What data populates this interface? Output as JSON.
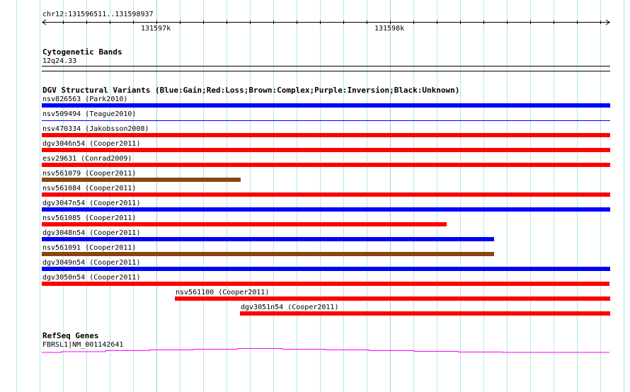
{
  "ruler": {
    "range_label": "chr12:131596511..131598937",
    "tick_labels": [
      "131597k",
      "131598k"
    ],
    "arrow_icon": "left-arrow-icon"
  },
  "cytoband": {
    "title": "Cytogenetic Bands",
    "band": "12q24.33"
  },
  "dgv": {
    "title": "DGV Structural Variants (Blue:Gain;Red:Loss;Brown:Complex;Purple:Inversion;Black:Unknown)",
    "colors": {
      "gain": "#0000ff",
      "loss": "#ff0000",
      "complex": "#8b4513"
    },
    "variants": [
      {
        "label": "nsv826563 (Park2010)",
        "type": "gain"
      },
      {
        "label": "nsv509494 (Teague2010)",
        "type": "gain"
      },
      {
        "label": "nsv470334 (Jakobsson2008)",
        "type": "loss"
      },
      {
        "label": "dgv3046n54 (Cooper2011)",
        "type": "loss"
      },
      {
        "label": "esv29631 (Conrad2009)",
        "type": "loss"
      },
      {
        "label": "nsv561079 (Cooper2011)",
        "type": "complex"
      },
      {
        "label": "nsv561084 (Cooper2011)",
        "type": "loss"
      },
      {
        "label": "dgv3047n54 (Cooper2011)",
        "type": "gain"
      },
      {
        "label": "nsv561085 (Cooper2011)",
        "type": "loss"
      },
      {
        "label": "dgv3048n54 (Cooper2011)",
        "type": "gain"
      },
      {
        "label": "nsv561091 (Cooper2011)",
        "type": "complex"
      },
      {
        "label": "dgv3049n54 (Cooper2011)",
        "type": "gain"
      },
      {
        "label": "dgv3050n54 (Cooper2011)",
        "type": "loss"
      },
      {
        "label": "nsv561100 (Cooper2011)",
        "type": "loss"
      },
      {
        "label": "dgv3051n54 (Cooper2011)",
        "type": "loss"
      }
    ]
  },
  "refseq": {
    "title": "RefSeq Genes",
    "gene": "FBRSL1|NM_001142641",
    "color": "#ff00ff"
  }
}
